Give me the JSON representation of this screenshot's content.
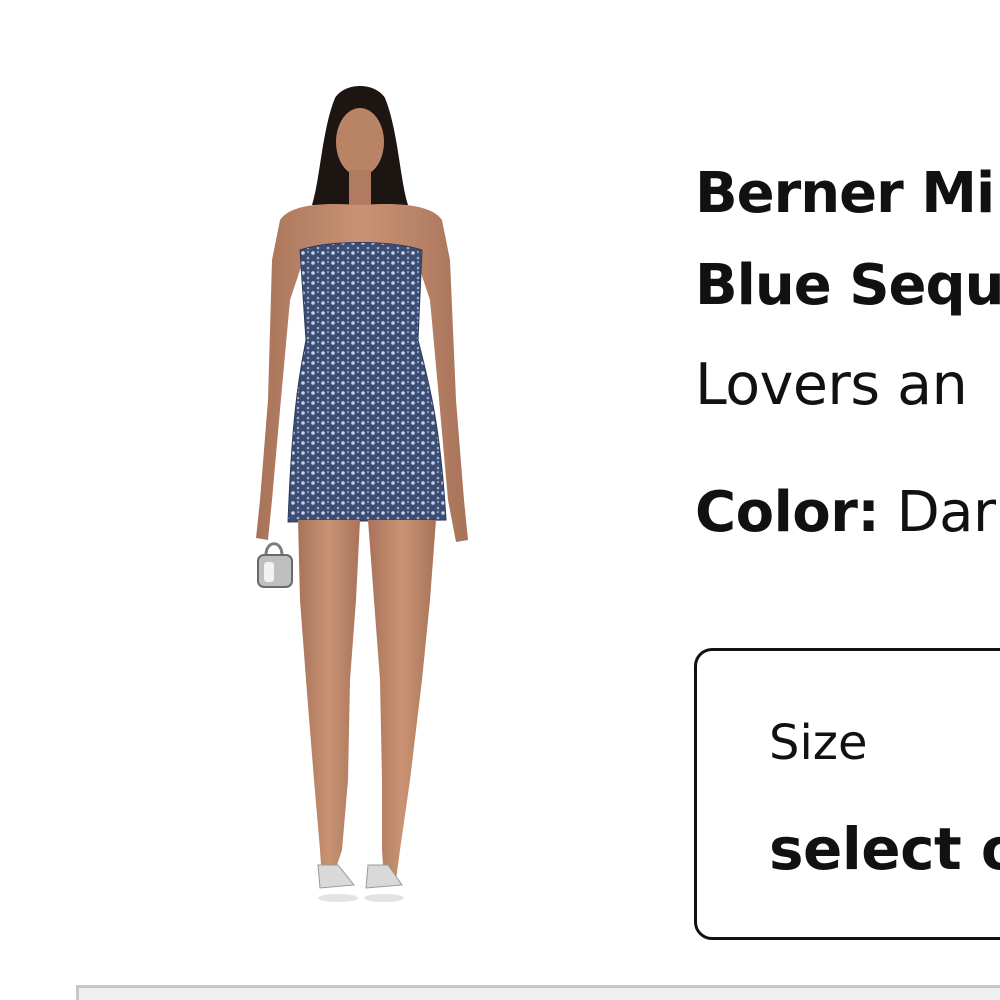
{
  "product": {
    "title_line1": "Berner Mi",
    "title_line2": "Blue Sequ",
    "brand": "Lovers an",
    "color_label": "Color:",
    "color_value": "Dar",
    "image_alt": "Model wearing strapless blue sequin mini dress"
  },
  "size_selector": {
    "label": "Size",
    "value": "select o"
  },
  "colors": {
    "dress": "#3c4d73",
    "sequin": "#b9c6e0",
    "skin": "#b98466",
    "hair": "#1c1512"
  }
}
